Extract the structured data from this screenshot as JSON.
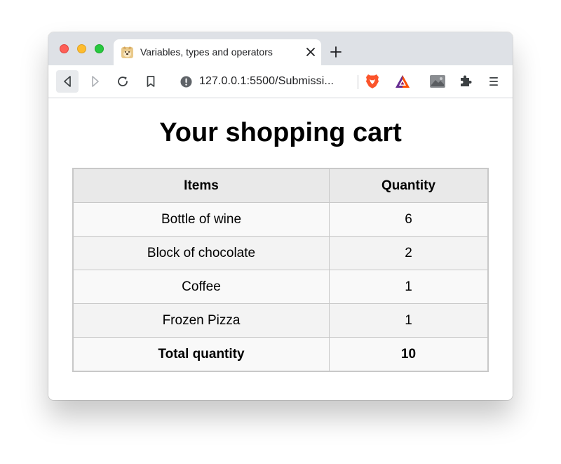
{
  "browser": {
    "tab": {
      "title": "Variables, types and operators",
      "favicon": "doge-favicon"
    },
    "address_bar": {
      "url": "127.0.0.1:5500/Submissi..."
    },
    "icons": [
      "back-icon",
      "forward-icon",
      "reload-icon",
      "bookmark-icon",
      "info-icon",
      "brave-shields-icon",
      "bat-rewards-icon",
      "extension-avatar-icon",
      "puzzle-icon",
      "menu-icon"
    ]
  },
  "page": {
    "title": "Your shopping cart",
    "table": {
      "headers": [
        "Items",
        "Quantity"
      ],
      "rows": [
        {
          "item": "Bottle of wine",
          "quantity": "6"
        },
        {
          "item": "Block of chocolate",
          "quantity": "2"
        },
        {
          "item": "Coffee",
          "quantity": "1"
        },
        {
          "item": "Frozen Pizza",
          "quantity": "1"
        }
      ],
      "footer": {
        "label": "Total quantity",
        "value": "10"
      }
    }
  },
  "colors": {
    "close": "#fe5f57",
    "minimize": "#febc2e",
    "maximize": "#28c840",
    "tabstrip": "#dee1e6",
    "header_bg": "#e9e9e9",
    "row_odd": "#f9f9f9",
    "row_even": "#f3f3f3",
    "border": "#c8c8c8",
    "brave_orange": "#fb542b"
  }
}
